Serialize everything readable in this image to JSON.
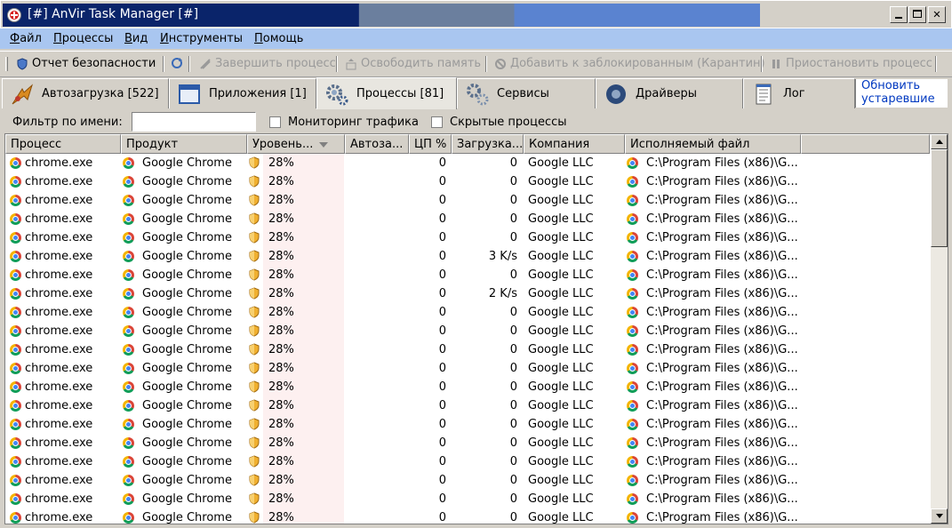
{
  "window": {
    "title": "[#] AnVir Task Manager [#]"
  },
  "menu": [
    {
      "label": "Файл",
      "u": "Ф",
      "rest": "айл"
    },
    {
      "label": "Процессы",
      "u": "П",
      "rest": "роцессы"
    },
    {
      "label": "Вид",
      "u": "В",
      "rest": "ид"
    },
    {
      "label": "Инструменты",
      "u": "И",
      "rest": "нструменты"
    },
    {
      "label": "Помощь",
      "u": "П",
      "rest": "омощь"
    }
  ],
  "toolbar": {
    "security_report": "Отчет безопасности",
    "end_process": "Завершить процесс",
    "free_memory": "Освободить память",
    "add_blocked": "Добавить к заблокированным (Карантин)",
    "suspend_process": "Приостановить процесс"
  },
  "tabs": [
    {
      "label": "Автозагрузка [522]",
      "icon": "startup-icon"
    },
    {
      "label": "Приложения [1]",
      "icon": "applications-icon"
    },
    {
      "label": "Процессы [81]",
      "icon": "processes-icon",
      "active": true
    },
    {
      "label": "Сервисы",
      "icon": "services-icon"
    },
    {
      "label": "Драйверы",
      "icon": "drivers-icon"
    },
    {
      "label": "Лог",
      "icon": "log-icon"
    }
  ],
  "update_link": "Обновить устаревшие",
  "filter": {
    "label": "Фильтр по имени:",
    "value": "",
    "traffic_monitoring": "Мониторинг трафика",
    "hidden_processes": "Скрытые процессы"
  },
  "columns": [
    "Процесс",
    "Продукт",
    "Уровень...",
    "Автоза...",
    "ЦП %",
    "Загрузка...",
    "Компания",
    "Исполняемый файл"
  ],
  "rows": [
    {
      "process": "chrome.exe",
      "product": "Google Chrome",
      "level": "28%",
      "autorun": "",
      "cpu": "0",
      "load": "0",
      "company": "Google LLC",
      "file": "C:\\Program Files (x86)\\G..."
    },
    {
      "process": "chrome.exe",
      "product": "Google Chrome",
      "level": "28%",
      "autorun": "",
      "cpu": "0",
      "load": "0",
      "company": "Google LLC",
      "file": "C:\\Program Files (x86)\\G..."
    },
    {
      "process": "chrome.exe",
      "product": "Google Chrome",
      "level": "28%",
      "autorun": "",
      "cpu": "0",
      "load": "0",
      "company": "Google LLC",
      "file": "C:\\Program Files (x86)\\G..."
    },
    {
      "process": "chrome.exe",
      "product": "Google Chrome",
      "level": "28%",
      "autorun": "",
      "cpu": "0",
      "load": "0",
      "company": "Google LLC",
      "file": "C:\\Program Files (x86)\\G..."
    },
    {
      "process": "chrome.exe",
      "product": "Google Chrome",
      "level": "28%",
      "autorun": "",
      "cpu": "0",
      "load": "0",
      "company": "Google LLC",
      "file": "C:\\Program Files (x86)\\G..."
    },
    {
      "process": "chrome.exe",
      "product": "Google Chrome",
      "level": "28%",
      "autorun": "",
      "cpu": "0",
      "load": "3 K/s",
      "company": "Google LLC",
      "file": "C:\\Program Files (x86)\\G..."
    },
    {
      "process": "chrome.exe",
      "product": "Google Chrome",
      "level": "28%",
      "autorun": "",
      "cpu": "0",
      "load": "0",
      "company": "Google LLC",
      "file": "C:\\Program Files (x86)\\G..."
    },
    {
      "process": "chrome.exe",
      "product": "Google Chrome",
      "level": "28%",
      "autorun": "",
      "cpu": "0",
      "load": "2 K/s",
      "company": "Google LLC",
      "file": "C:\\Program Files (x86)\\G..."
    },
    {
      "process": "chrome.exe",
      "product": "Google Chrome",
      "level": "28%",
      "autorun": "",
      "cpu": "0",
      "load": "0",
      "company": "Google LLC",
      "file": "C:\\Program Files (x86)\\G..."
    },
    {
      "process": "chrome.exe",
      "product": "Google Chrome",
      "level": "28%",
      "autorun": "",
      "cpu": "0",
      "load": "0",
      "company": "Google LLC",
      "file": "C:\\Program Files (x86)\\G..."
    },
    {
      "process": "chrome.exe",
      "product": "Google Chrome",
      "level": "28%",
      "autorun": "",
      "cpu": "0",
      "load": "0",
      "company": "Google LLC",
      "file": "C:\\Program Files (x86)\\G..."
    },
    {
      "process": "chrome.exe",
      "product": "Google Chrome",
      "level": "28%",
      "autorun": "",
      "cpu": "0",
      "load": "0",
      "company": "Google LLC",
      "file": "C:\\Program Files (x86)\\G..."
    },
    {
      "process": "chrome.exe",
      "product": "Google Chrome",
      "level": "28%",
      "autorun": "",
      "cpu": "0",
      "load": "0",
      "company": "Google LLC",
      "file": "C:\\Program Files (x86)\\G..."
    },
    {
      "process": "chrome.exe",
      "product": "Google Chrome",
      "level": "28%",
      "autorun": "",
      "cpu": "0",
      "load": "0",
      "company": "Google LLC",
      "file": "C:\\Program Files (x86)\\G..."
    },
    {
      "process": "chrome.exe",
      "product": "Google Chrome",
      "level": "28%",
      "autorun": "",
      "cpu": "0",
      "load": "0",
      "company": "Google LLC",
      "file": "C:\\Program Files (x86)\\G..."
    },
    {
      "process": "chrome.exe",
      "product": "Google Chrome",
      "level": "28%",
      "autorun": "",
      "cpu": "0",
      "load": "0",
      "company": "Google LLC",
      "file": "C:\\Program Files (x86)\\G..."
    },
    {
      "process": "chrome.exe",
      "product": "Google Chrome",
      "level": "28%",
      "autorun": "",
      "cpu": "0",
      "load": "0",
      "company": "Google LLC",
      "file": "C:\\Program Files (x86)\\G..."
    },
    {
      "process": "chrome.exe",
      "product": "Google Chrome",
      "level": "28%",
      "autorun": "",
      "cpu": "0",
      "load": "0",
      "company": "Google LLC",
      "file": "C:\\Program Files (x86)\\G..."
    },
    {
      "process": "chrome.exe",
      "product": "Google Chrome",
      "level": "28%",
      "autorun": "",
      "cpu": "0",
      "load": "0",
      "company": "Google LLC",
      "file": "C:\\Program Files (x86)\\G..."
    },
    {
      "process": "chrome.exe",
      "product": "Google Chrome",
      "level": "28%",
      "autorun": "",
      "cpu": "0",
      "load": "0",
      "company": "Google LLC",
      "file": "C:\\Program Files (x86)\\G..."
    }
  ],
  "colors": {
    "title_active": "#0a246a",
    "menubar": "#a9c6f0",
    "pink_column": "#fdf0f0",
    "link": "#0038c0"
  }
}
